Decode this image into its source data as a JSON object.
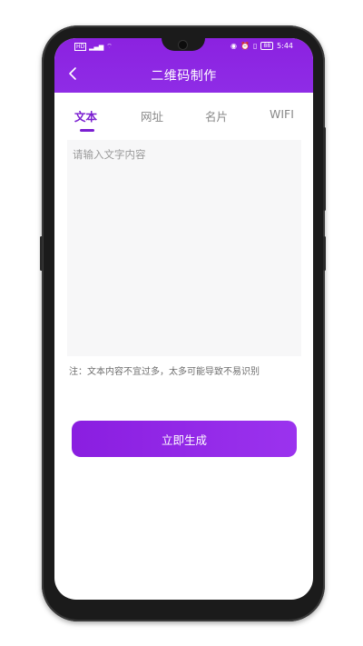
{
  "status_bar": {
    "left_text": "HD",
    "time": "5:44",
    "battery": "88"
  },
  "header": {
    "title": "二维码制作",
    "back_label": "<"
  },
  "tabs": [
    {
      "label": "文本",
      "active": true
    },
    {
      "label": "网址",
      "active": false
    },
    {
      "label": "名片",
      "active": false
    },
    {
      "label": "WIFI",
      "active": false
    }
  ],
  "input": {
    "placeholder": "请输入文字内容",
    "value": ""
  },
  "note": "注：文本内容不宜过多，太多可能导致不易识别",
  "generate_button": "立即生成",
  "colors": {
    "accent": "#8a2be2",
    "tab_active": "#7b1fd1"
  }
}
